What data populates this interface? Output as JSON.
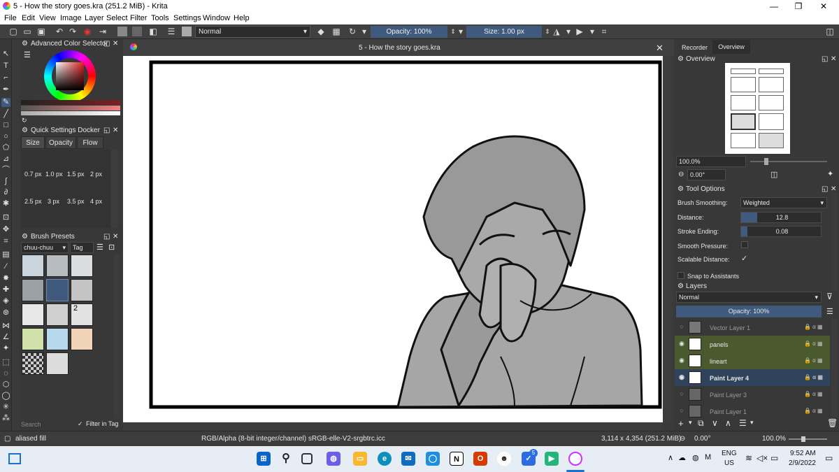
{
  "window": {
    "title": "5 - How the story goes.kra (251.2 MiB) - Krita",
    "minimize": "—",
    "maximize": "❐",
    "close": "✕"
  },
  "menu": [
    "File",
    "Edit",
    "View",
    "Image",
    "Layer",
    "Select",
    "Filter",
    "Tools",
    "Settings",
    "Window",
    "Help"
  ],
  "toolbar": {
    "blend_mode": "Normal",
    "opacity": "Opacity: 100%",
    "size": "Size: 1.00 px"
  },
  "left_dock": {
    "color_selector_title": "Advanced Color Selector",
    "quick_settings_title": "Quick Settings Docker",
    "tabs": [
      "Size",
      "Opacity",
      "Flow"
    ],
    "sizes_row1": [
      "0.7 px",
      "1.0 px",
      "1.5 px",
      "2 px"
    ],
    "sizes_row2": [
      "2.5 px",
      "3 px",
      "3.5 px",
      "4 px"
    ],
    "brush_presets_title": "Brush Presets",
    "preset_tag": "chuu-chuu",
    "tag_button": "Tag",
    "search_placeholder": "Search",
    "filter_in_tag": "Filter in Tag",
    "preset_count_label": "2"
  },
  "document": {
    "tab_title": "5 - How the story goes.kra"
  },
  "right_dock": {
    "tabs": [
      "Recorder",
      "Overview"
    ],
    "overview_title": "Overview",
    "zoom": "100.0%",
    "rotation": "0.00°",
    "tool_options_title": "Tool Options",
    "brush_smoothing_label": "Brush Smoothing:",
    "brush_smoothing_value": "Weighted",
    "distance_label": "Distance:",
    "distance_value": "12.8",
    "stroke_ending_label": "Stroke Ending:",
    "stroke_ending_value": "0.08",
    "smooth_pressure_label": "Smooth Pressure:",
    "scalable_distance_label": "Scalable Distance:",
    "snap_label": "Snap to Assistants",
    "layers_title": "Layers",
    "layers_blend": "Normal",
    "layers_opacity": "Opacity:  100%",
    "layers": [
      {
        "name": "Vector Layer 1",
        "visible": false,
        "style": "dim"
      },
      {
        "name": "panels",
        "visible": true,
        "style": "green"
      },
      {
        "name": "lineart",
        "visible": true,
        "style": "green"
      },
      {
        "name": "Paint Layer 4",
        "visible": true,
        "style": "selected"
      },
      {
        "name": "Paint Layer 3",
        "visible": false,
        "style": "dim"
      },
      {
        "name": "Paint Layer 1",
        "visible": false,
        "style": "dim"
      }
    ],
    "layer_flags": "🔒 α ▦"
  },
  "status": {
    "tool": "aliased fill",
    "colorspace": "RGB/Alpha (8-bit integer/channel)  sRGB-elle-V2-srgbtrc.icc",
    "dimensions": "3,114 x 4,354 (251.2 MiB)",
    "rotation": "0.00°",
    "zoom": "100.0%"
  },
  "taskbar": {
    "lang": "ENG",
    "region": "US",
    "time": "9:52 AM",
    "date": "2/9/2022",
    "badge": "5"
  },
  "colors": {
    "accent": "#3f5a7d",
    "panel": "#383838",
    "layer_green": "#4b5a2e",
    "layer_selected": "#30435c"
  }
}
